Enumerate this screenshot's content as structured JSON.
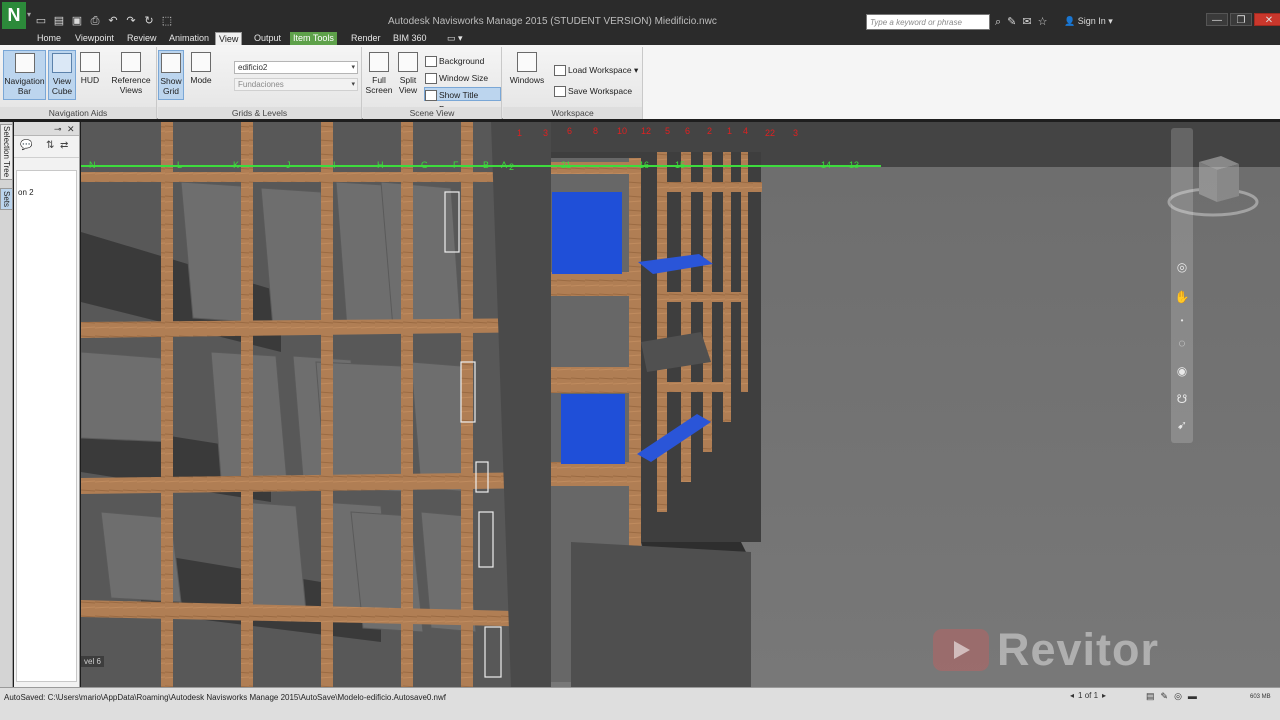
{
  "titlebar": {
    "app_logo": "N",
    "document_title": "Autodesk Navisworks Manage 2015 (STUDENT VERSION)    Miedificio.nwc",
    "search_placeholder": "Type a keyword or phrase",
    "sign_in": "Sign In"
  },
  "tabs": [
    "Home",
    "Viewpoint",
    "Review",
    "Animation",
    "View",
    "Output",
    "Item Tools",
    "Render",
    "BIM 360"
  ],
  "active_tab": "View",
  "context_tab": "Item Tools",
  "ribbon": {
    "navigation_aids": {
      "title": "Navigation Aids",
      "navigation_bar": "Navigation Bar",
      "view_cube": "View Cube",
      "hud": "HUD",
      "reference_views": "Reference Views"
    },
    "grids_levels": {
      "title": "Grids & Levels",
      "show_grid": "Show Grid",
      "mode": "Mode",
      "grid_model": "edificio2",
      "level": "Fundaciones"
    },
    "scene_view": {
      "title": "Scene View",
      "full_screen": "Full Screen",
      "split_view": "Split View",
      "background": "Background",
      "window_size": "Window Size",
      "show_title_bars": "Show Title Bars"
    },
    "workspace": {
      "title": "Workspace",
      "windows": "Windows",
      "load_workspace": "Load Workspace",
      "save_workspace": "Save Workspace"
    }
  },
  "dock": {
    "tab_selection_tree": "Selection Tree",
    "tab_sets": "Sets",
    "list_item": "on 2"
  },
  "viewport": {
    "level_tag": "vel 6",
    "grid_labels_green": [
      "N",
      "L",
      "K",
      "J",
      "I",
      "H",
      "G",
      "F",
      "B",
      "A",
      "2",
      "21",
      "16",
      "15",
      "14",
      "13"
    ],
    "grid_labels_red": [
      "1",
      "3",
      "6",
      "8",
      "10",
      "12",
      "5",
      "6",
      "2",
      "1",
      "4",
      "22",
      "3"
    ]
  },
  "watermark": "Revitor",
  "status": {
    "autosave": "AutoSaved: C:\\Users\\mario\\AppData\\Roaming\\Autodesk Navisworks Manage 2015\\AutoSave\\Modelo-edificio.Autosave0.nwf",
    "pager": "1 of 1",
    "memory": "603 MB"
  },
  "colors": {
    "accent_green": "#2c8a3a",
    "grid_green": "#3ddc3d",
    "grid_red": "#e02020",
    "wood": "#b07e54",
    "panel_blue": "#1f4fd8"
  },
  "icons": {
    "navigation_bar": "navigation-bar-icon",
    "view_cube": "view-cube-icon",
    "hud": "hud-icon",
    "reference_views": "reference-views-icon",
    "show_grid": "grid-icon",
    "mode": "mode-icon",
    "full_screen": "fullscreen-icon",
    "split_view": "split-view-icon",
    "windows": "windows-icon"
  }
}
